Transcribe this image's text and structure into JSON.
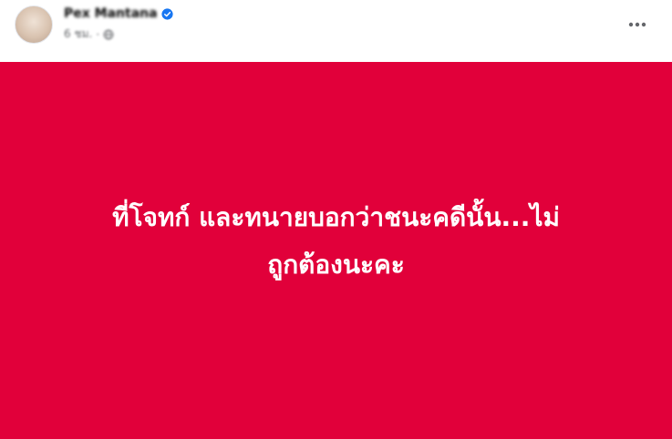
{
  "post": {
    "author_name": "Pex Mantana",
    "time": "6 ชม.",
    "separator": "·",
    "privacy_icon": "globe-icon",
    "verified_icon": "verified-badge-icon",
    "more_icon": "more-options-icon",
    "background_color": "#e1003a",
    "text_lines": [
      "ที่โจทก์ และทนายบอกว่าชนะคดีนั้น...ไม่",
      "ถูกต้องนะคะ"
    ]
  }
}
